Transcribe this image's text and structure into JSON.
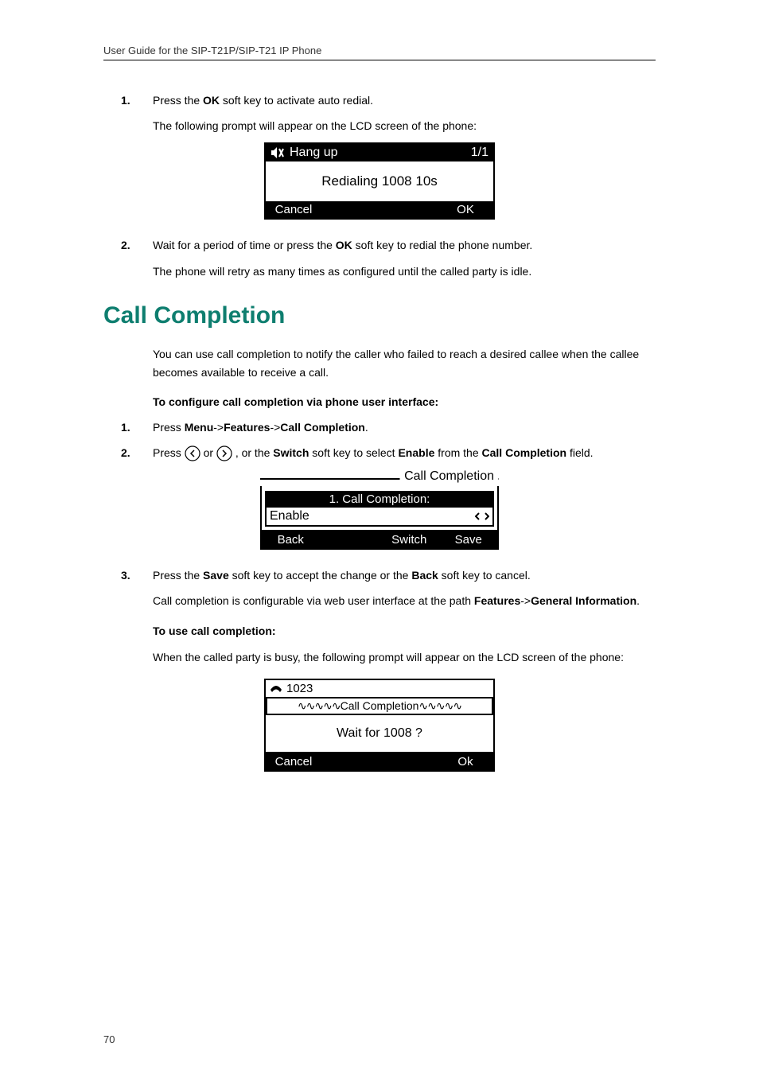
{
  "header": {
    "running_head": "User Guide for the SIP-T21P/SIP-T21 IP Phone"
  },
  "section1": {
    "step1": {
      "num": "1.",
      "text_pre": "Press the ",
      "text_bold1": "OK",
      "text_post1": " soft key to activate auto redial.",
      "sub": "The following prompt will appear on the LCD screen of the phone:"
    },
    "lcd1": {
      "top_left_icon": "speaker-mute-icon",
      "top_left_text": "Hang up",
      "top_right": "1/1",
      "mid": "Redialing 1008 10s",
      "soft": [
        "Cancel",
        "",
        "",
        "OK"
      ]
    },
    "step2": {
      "num": "2.",
      "text_pre": "Wait for a period of time or press the ",
      "text_bold1": "OK",
      "text_post1": " soft key to redial the phone number."
    },
    "closing": "The phone will retry as many times as configured until the called party is idle."
  },
  "heading": "Call Completion",
  "section2": {
    "intro": "You can use call completion to notify the caller who failed to reach a desired callee when the callee becomes available to receive a call.",
    "configure_label": "To configure call completion via phone user interface:",
    "step1": {
      "num": "1.",
      "pre": "Press ",
      "b1": "Menu",
      "sep1": "->",
      "b2": "Features",
      "sep2": "->",
      "b3": "Call Completion",
      "post": "."
    },
    "step2": {
      "num": "2.",
      "pre": "Press ",
      "mid1": " or ",
      "mid2": " , or the ",
      "b1": "Switch",
      "mid3": " soft key to select ",
      "b2": "Enable",
      "mid4": " from the ",
      "b3": "Call Completion",
      "post": " field."
    },
    "lcd2": {
      "title": "Call Completion",
      "row1": "1. Call Completion:",
      "row2": "Enable",
      "arrows_icon": "left-right-arrows-icon",
      "soft": [
        "Back",
        "",
        "Switch",
        "Save"
      ]
    },
    "step3": {
      "num": "3.",
      "pre": "Press the ",
      "b1": "Save",
      "mid1": " soft key to accept the change or the ",
      "b2": "Back",
      "post": " soft key to cancel."
    },
    "webpath": {
      "pre": "Call completion is configurable via web user interface at the path ",
      "b1": "Features",
      "sep": "->",
      "b2": "General Information",
      "post": "."
    },
    "use_label": "To use call completion:",
    "use_body": "When the called party is busy, the following prompt will appear on the LCD screen of the phone:",
    "lcd3": {
      "top_icon": "handset-icon",
      "top_text": "1023",
      "wave_left": "∿∿∿∿∿",
      "wave_title": "Call Completion",
      "wave_right": "∿∿∿∿∿",
      "mid": "Wait for 1008 ?",
      "soft": [
        "Cancel",
        "",
        "",
        "Ok"
      ]
    }
  },
  "page_number": "70"
}
